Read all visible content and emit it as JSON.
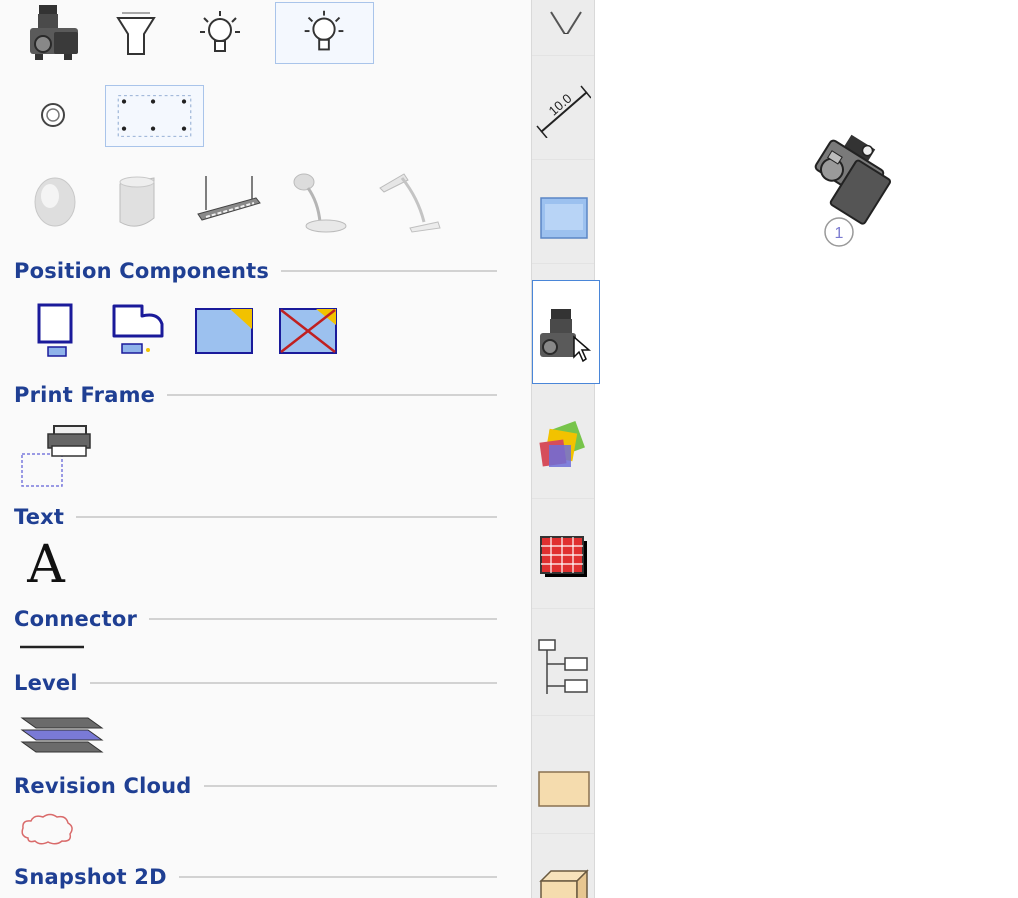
{
  "palette": {
    "sections": {
      "position_components": "Position Components",
      "print_frame": "Print Frame",
      "text": "Text",
      "connector": "Connector",
      "level": "Level",
      "revision_cloud": "Revision Cloud",
      "snapshot_2d": "Snapshot 2D"
    },
    "text_tool_glyph": "A",
    "row1_icons": [
      "camera-icon",
      "lampshade-icon",
      "light-bulb-icon",
      "light-bulb-icon"
    ],
    "row2_icons": [
      "spot-light-icon",
      "light-grid-icon"
    ],
    "row3_icons": [
      "wall-lamp-icon",
      "cylinder-lamp-icon",
      "ceiling-fixture-icon",
      "desk-lamp-icon",
      "desk-lamp-icon"
    ],
    "position_icons": [
      "viewport-icon",
      "viewport-profile-icon",
      "viewport-image-icon",
      "viewport-crossed-icon"
    ]
  },
  "tabs": {
    "dimension_label": "10.0",
    "active": "camera"
  },
  "canvas": {
    "camera_number": "1"
  },
  "colors": {
    "section_title": "#1f3f93",
    "rule": "#d2d2d2",
    "active_tab_border": "#4a86d8",
    "selection_border": "#a9c4ea"
  }
}
